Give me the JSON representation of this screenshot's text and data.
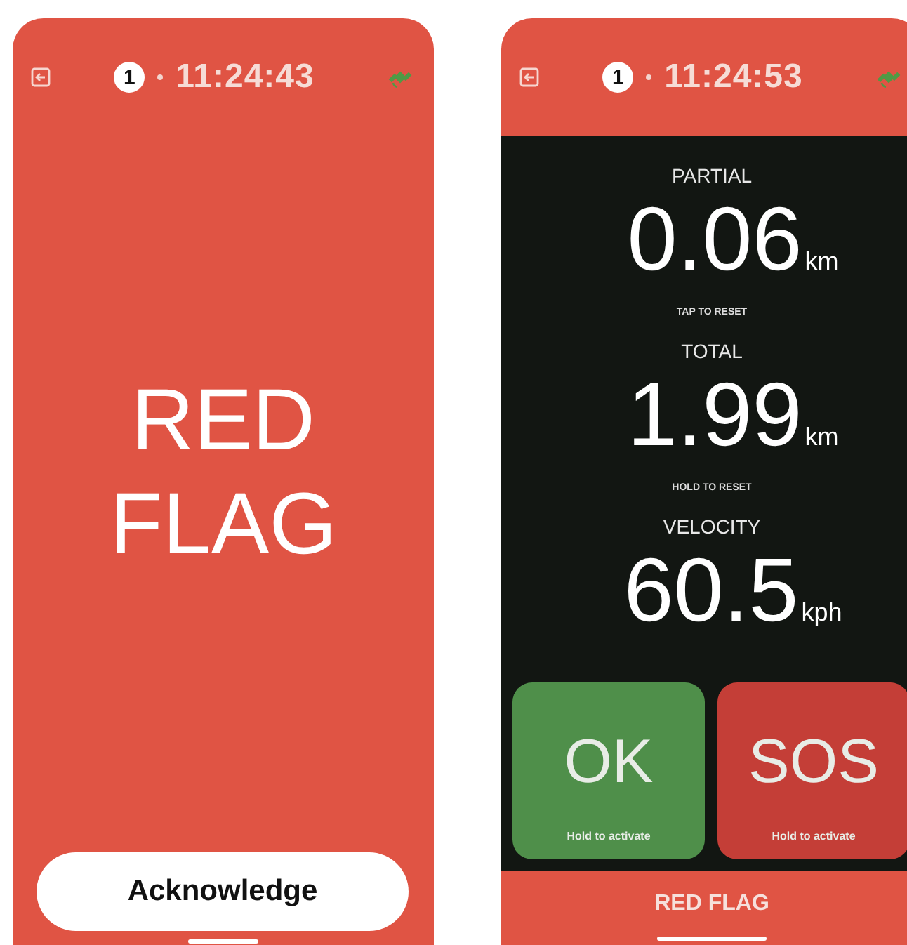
{
  "screens": [
    {
      "kind": "alert",
      "header": {
        "badge": "1",
        "time": "11:24:43"
      },
      "message_lines": [
        "RED",
        "FLAG"
      ],
      "button": "Acknowledge"
    },
    {
      "kind": "dashboard",
      "header": {
        "badge": "1",
        "time": "11:24:53"
      },
      "metrics": [
        {
          "label": "PARTIAL",
          "value": "0.06",
          "unit": "km",
          "hint": "TAP TO RESET"
        },
        {
          "label": "TOTAL",
          "value": "1.99",
          "unit": "km",
          "hint": "HOLD TO RESET"
        },
        {
          "label": "VELOCITY",
          "value": "60.5",
          "unit": "kph"
        }
      ],
      "actions": [
        {
          "label": "OK",
          "hint": "Hold to activate",
          "color": "#4f8f4a"
        },
        {
          "label": "SOS",
          "hint": "Hold to activate",
          "color": "#c43e37"
        }
      ],
      "footer": "RED FLAG"
    }
  ]
}
